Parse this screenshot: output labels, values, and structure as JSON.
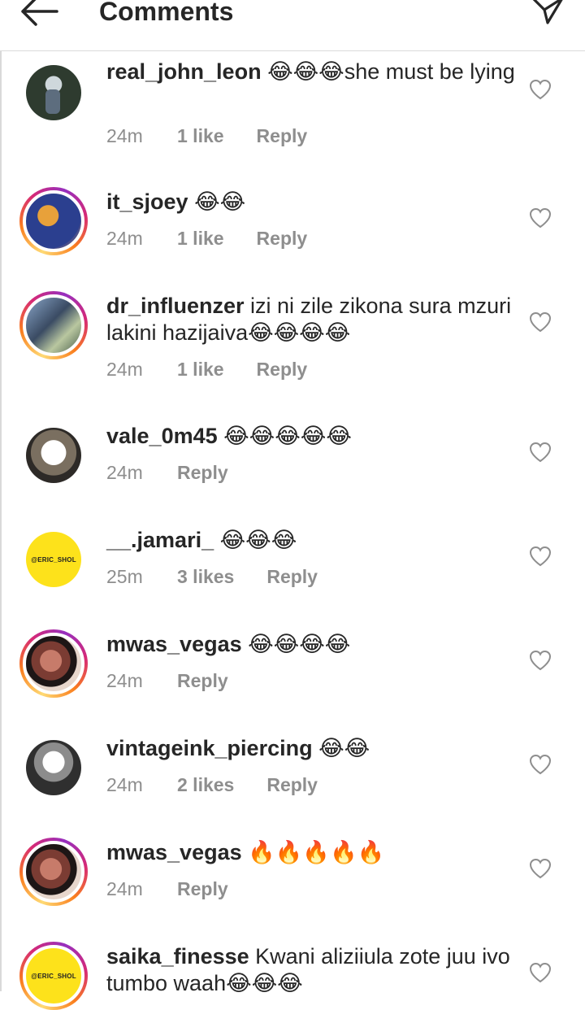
{
  "header": {
    "title": "Comments",
    "back_icon": "arrow-left-icon",
    "send_icon": "paper-plane-icon"
  },
  "comments": [
    {
      "username": "real_john_leon",
      "text": " 😂😂😂she must be lying",
      "time": "24m",
      "likes": "1 like",
      "reply": "Reply"
    },
    {
      "username": "it_sjoey",
      "text": " 😂😂",
      "time": "24m",
      "likes": "1 like",
      "reply": "Reply"
    },
    {
      "username": "dr_influenzer",
      "text": " izi ni zile zikona sura mzuri lakini hazijaiva😂😂😂😂",
      "time": "24m",
      "likes": "1 like",
      "reply": "Reply"
    },
    {
      "username": "vale_0m45",
      "text": " 😂😂😂😂😂",
      "time": "24m",
      "likes": "",
      "reply": "Reply"
    },
    {
      "username": "__.jamari_",
      "text": " 😂😂😂",
      "time": "25m",
      "likes": "3 likes",
      "reply": "Reply",
      "avatar_text": "@ERIC_SHOL"
    },
    {
      "username": "mwas_vegas",
      "text": " 😂😂😂😂",
      "time": "24m",
      "likes": "",
      "reply": "Reply"
    },
    {
      "username": "vintageink_piercing",
      "text": " 😂😂",
      "time": "24m",
      "likes": "2 likes",
      "reply": "Reply"
    },
    {
      "username": "mwas_vegas",
      "text": " 🔥🔥🔥🔥🔥",
      "time": "24m",
      "likes": "",
      "reply": "Reply"
    },
    {
      "username": "saika_finesse",
      "text": " Kwani aliziiula zote juu ivo tumbo waah😂😂😂",
      "time": "",
      "likes": "",
      "reply": "",
      "avatar_text": "@ERIC_SHOL"
    }
  ],
  "icons": {
    "like": "heart-outline-icon"
  },
  "colors": {
    "text": "#262626",
    "meta": "#8e8e8e",
    "avatar_yellow": "#fde21b"
  }
}
